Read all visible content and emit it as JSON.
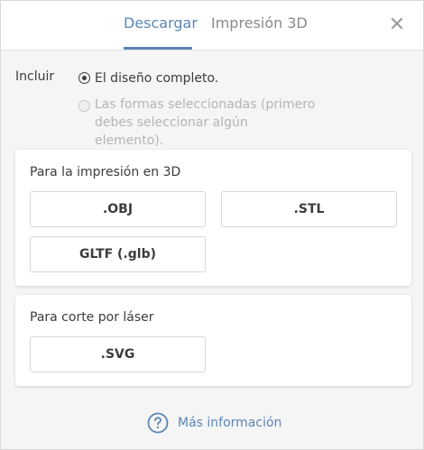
{
  "tabs": [
    {
      "label": "Descargar",
      "active": true
    },
    {
      "label": "Impresión 3D",
      "active": false
    }
  ],
  "include": {
    "label": "Incluir",
    "options": [
      {
        "label": "El diseño completo.",
        "selected": true,
        "disabled": false
      },
      {
        "label": "Las formas seleccionadas (primero debes seleccionar algún elemento).",
        "selected": false,
        "disabled": true
      }
    ]
  },
  "print3d": {
    "title": "Para la impresión en 3D",
    "buttons": [
      ".OBJ",
      ".STL",
      "GLTF (.glb)"
    ]
  },
  "laser": {
    "title": "Para corte por láser",
    "buttons": [
      ".SVG"
    ]
  },
  "more_info": {
    "label": "Más información",
    "icon": "help-circle-icon"
  },
  "colors": {
    "accent": "#5b86b6",
    "text": "#3c3c3c",
    "disabled_text": "#b4b4b4",
    "background": "#f5f5f6"
  }
}
